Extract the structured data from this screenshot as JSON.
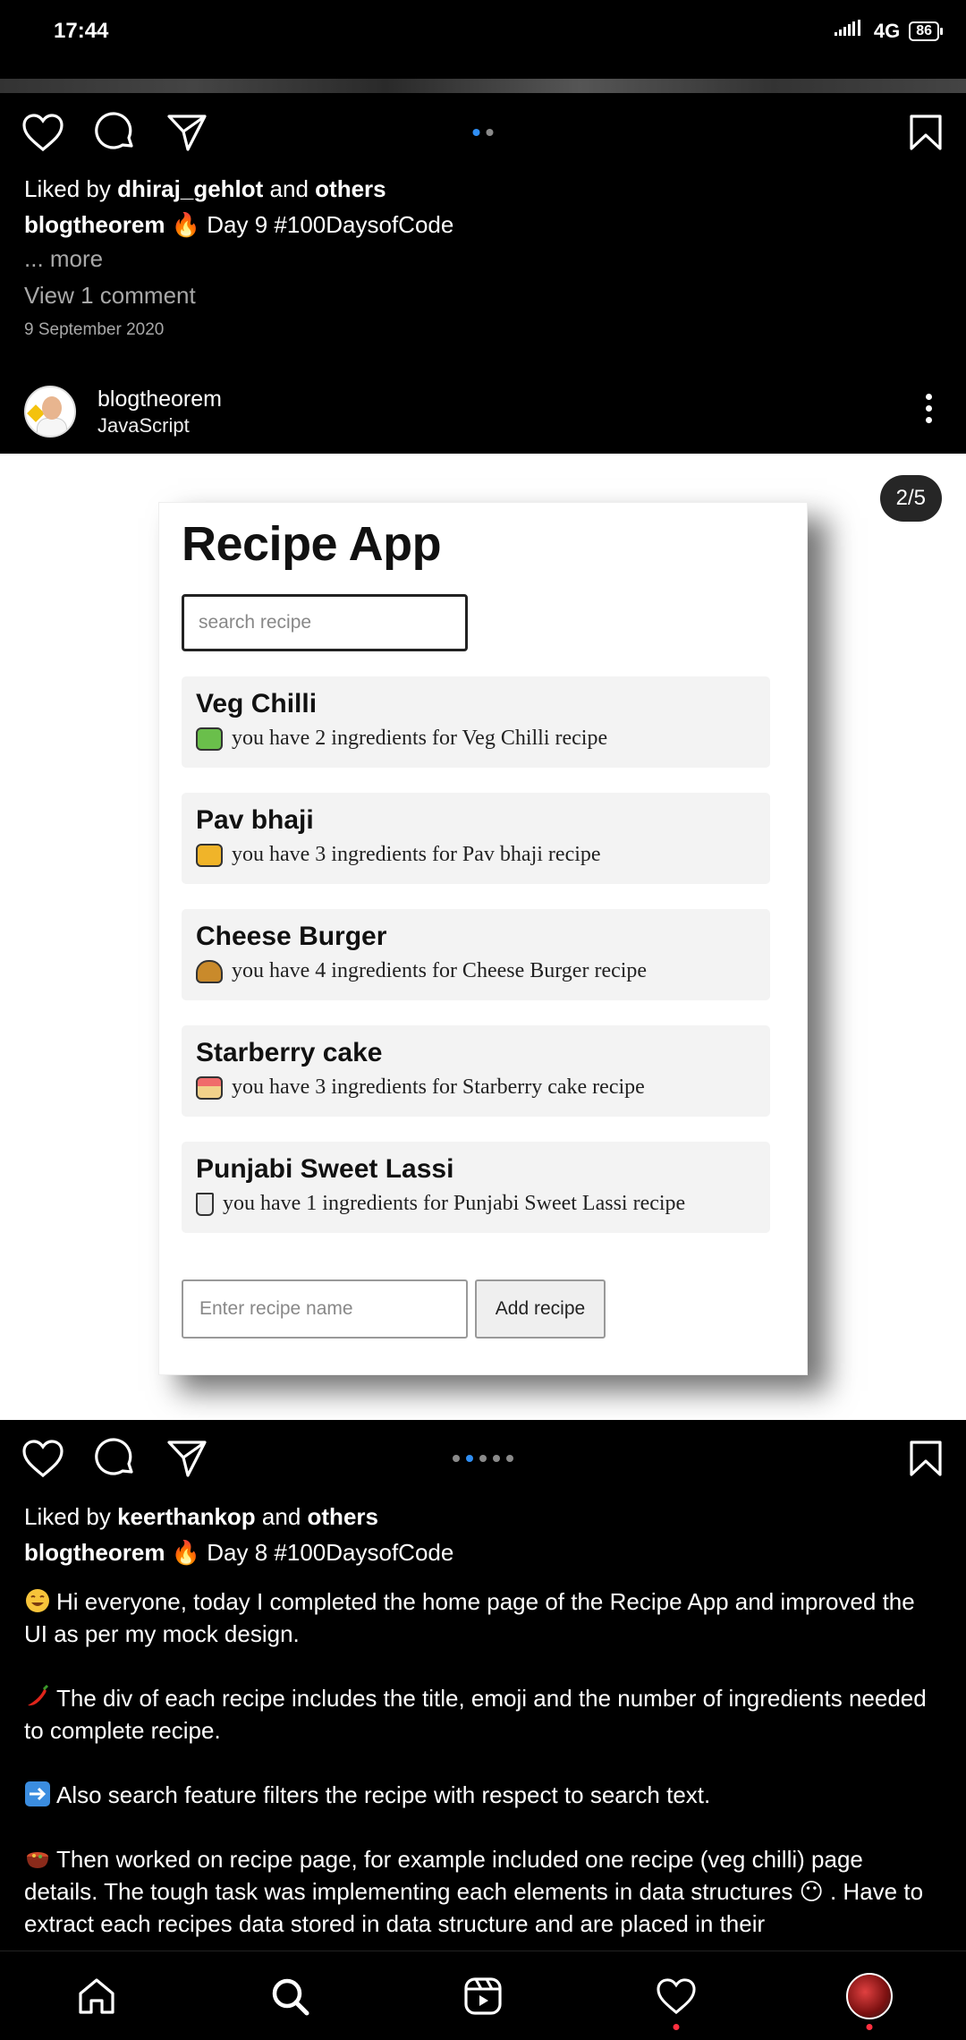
{
  "status_bar": {
    "time": "17:44",
    "network": "4G",
    "battery": "86"
  },
  "post1": {
    "liked_prefix": "Liked by ",
    "liked_user": "dhiraj_gehlot",
    "liked_suffix": " and ",
    "liked_others": "others",
    "caption_user": "blogtheorem",
    "caption_text": " 🔥 Day 9 #100DaysofCode",
    "more": "... more",
    "comments": "View 1 comment",
    "date": "9 September 2020"
  },
  "post2": {
    "username": "blogtheorem",
    "subtitle": "JavaScript",
    "counter": "2/5",
    "app": {
      "title": "Recipe App",
      "search_placeholder": "search recipe",
      "recipes": [
        {
          "title": "Veg Chilli",
          "desc": "you have 2 ingredients for Veg Chilli recipe",
          "emoji_color": "#6abf4b"
        },
        {
          "title": "Pav bhaji",
          "desc": "you have 3 ingredients for Pav bhaji recipe",
          "emoji_color": "#f0b429"
        },
        {
          "title": "Cheese Burger",
          "desc": "you have 4 ingredients for Cheese Burger recipe",
          "emoji_color": "#c98a2b"
        },
        {
          "title": "Starberry cake",
          "desc": "you have 3 ingredients for Starberry cake recipe",
          "emoji_color": "#f2a65a"
        },
        {
          "title": "Punjabi Sweet Lassi",
          "desc": "you have 1 ingredients for Punjabi Sweet Lassi recipe",
          "emoji_color": "#d9d9d9"
        }
      ],
      "add_placeholder": "Enter recipe name",
      "add_button": "Add recipe"
    },
    "liked_prefix": "Liked by ",
    "liked_user": "keerthankop",
    "liked_suffix": " and ",
    "liked_others": "others",
    "caption_user": "blogtheorem",
    "caption_text": " 🔥 Day 8 #100DaysofCode",
    "paragraphs": [
      {
        "emoji": "smile",
        "text": "Hi everyone, today I completed the home page of the Recipe App and improved the UI as per my mock design."
      },
      {
        "emoji": "chili",
        "text": "The div of each recipe includes the title, emoji and the number of ingredients needed to complete recipe."
      },
      {
        "emoji": "arrow",
        "text": "Also search feature filters the recipe with respect to search text."
      },
      {
        "emoji": "pot",
        "text": "Then worked on recipe page, for example included one recipe (veg chilli) page details. The tough task was implementing each elements in data structures 😶 . Have to extract each recipes data stored in data structure and are placed in their"
      }
    ]
  },
  "colors": {
    "accent": "#2f8ef4",
    "notification": "#ff3040"
  }
}
